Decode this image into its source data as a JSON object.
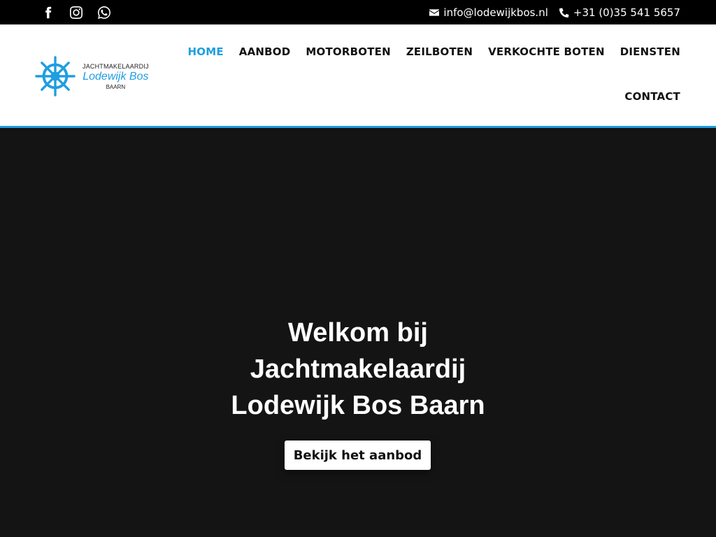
{
  "topbar": {
    "socials": [
      {
        "icon": "facebook-icon"
      },
      {
        "icon": "instagram-icon"
      },
      {
        "icon": "whatsapp-icon"
      }
    ],
    "email": "info@lodewijkbos.nl",
    "phone": "+31 (0)35 541 5657"
  },
  "logo": {
    "line1": "JACHTMAKELAARDIJ",
    "line2": "Lodewijk Bos",
    "line3": "BAARN",
    "icon": "ship-wheel-icon"
  },
  "nav": {
    "items": [
      {
        "label": "HOME",
        "active": true
      },
      {
        "label": "AANBOD"
      },
      {
        "label": "MOTORBOTEN"
      },
      {
        "label": "ZEILBOTEN"
      },
      {
        "label": "VERKOCHTE BOTEN"
      },
      {
        "label": "DIENSTEN"
      },
      {
        "label": "CONTACT"
      }
    ]
  },
  "hero": {
    "title_line1": "Welkom bij",
    "title_line2": "Jachtmakelaardij",
    "title_line3": "Lodewijk Bos Baarn",
    "button_label": "Bekijk het aanbod"
  },
  "colors": {
    "accent": "#1f9ee0",
    "topbar_bg": "#000000",
    "hero_bg": "#141414"
  }
}
